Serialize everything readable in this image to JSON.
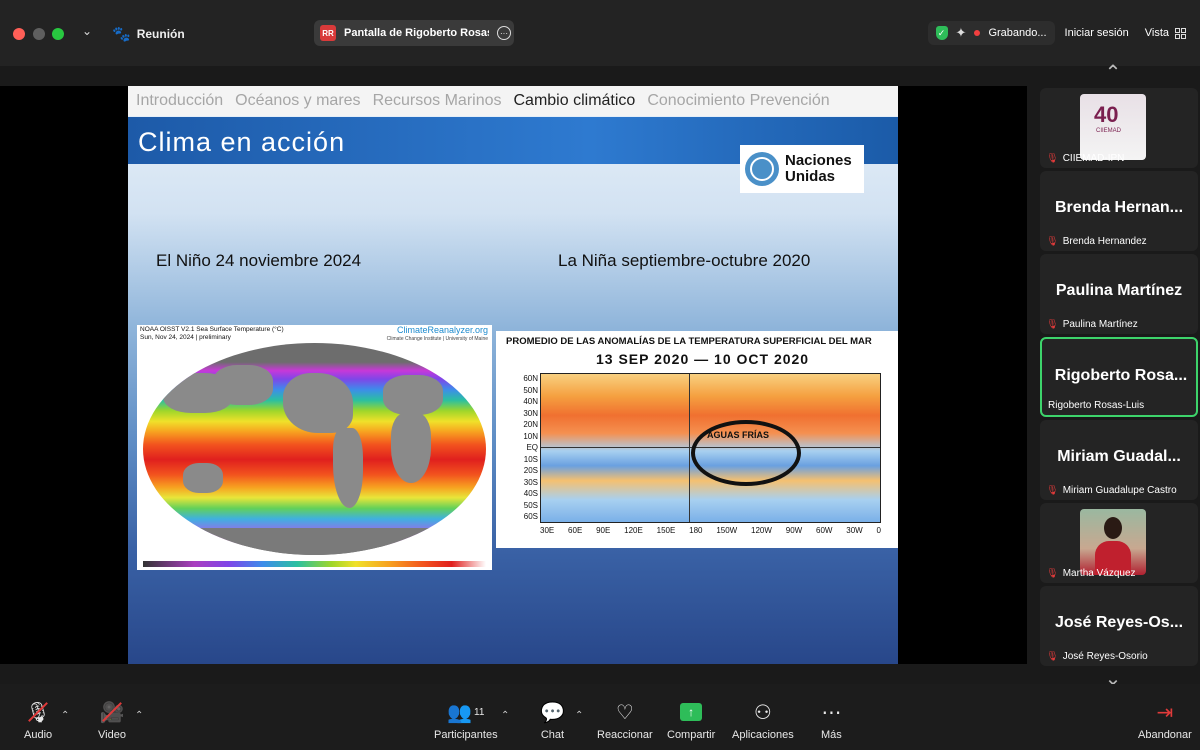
{
  "titlebar": {
    "app_title": "Reunión",
    "share_tab_badge": "RR",
    "share_tab_label": "Pantalla de Rigoberto Rosas-Luis",
    "recording_label": "Grabando...",
    "signin_label": "Iniciar sesión",
    "view_label": "Vista"
  },
  "slide": {
    "nav": [
      "Introducción",
      "Océanos y mares",
      "Recursos Marinos",
      "Cambio climático",
      "Conocimiento Prevención"
    ],
    "active_nav": 3,
    "title": "Clima en acción",
    "logo_text_1": "Naciones",
    "logo_text_2": "Unidas",
    "caption_left": "El Niño 24 noviembre 2024",
    "caption_right": "La Niña septiembre-octubre 2020",
    "map1": {
      "header_1": "NOAA OISST V2.1 Sea Surface Temperature (°C)",
      "header_2": "Sun, Nov 24, 2024 | preliminary",
      "brand": "ClimateReanalyzer.org",
      "brand_sub": "Climate Change Institute | University of Maine"
    },
    "map2": {
      "title_1": "PROMEDIO DE LAS ANOMALÍAS DE LA TEMPERATURA SUPERFICIAL DEL MAR",
      "title_2": "13 SEP 2020 — 10 OCT 2020",
      "annotation": "AGUAS FRÍAS",
      "y_ticks": [
        "60N",
        "50N",
        "40N",
        "30N",
        "20N",
        "10N",
        "EQ",
        "10S",
        "20S",
        "30S",
        "40S",
        "50S",
        "60S"
      ],
      "x_ticks": [
        "30E",
        "60E",
        "90E",
        "120E",
        "150E",
        "180",
        "150W",
        "120W",
        "90W",
        "60W",
        "30W",
        "0"
      ]
    }
  },
  "gallery": {
    "tiles": [
      {
        "name": "",
        "label": "CIIEMAD-IPN",
        "thumb": "ciiemad",
        "thumb_text": "40",
        "thumb_sub": "CIIEMAD"
      },
      {
        "name": "Brenda Hernan...",
        "label": "Brenda Hernandez"
      },
      {
        "name": "Paulina Martínez",
        "label": "Paulina Martínez"
      },
      {
        "name": "Rigoberto Rosa...",
        "label": "Rigoberto Rosas-Luis",
        "active": true
      },
      {
        "name": "Miriam Guadal...",
        "label": "Miriam Guadalupe Castro"
      },
      {
        "name": "",
        "label": "Martha Vázquez",
        "thumb": "martha"
      },
      {
        "name": "José Reyes-Os...",
        "label": "José Reyes-Osorio"
      }
    ]
  },
  "toolbar": {
    "audio": "Audio",
    "video": "Video",
    "participants": "Participantes",
    "participants_count": "11",
    "chat": "Chat",
    "react": "Reaccionar",
    "share": "Compartir",
    "apps": "Aplicaciones",
    "more": "Más",
    "leave": "Abandonar"
  },
  "colors": {
    "recording_dot": "#f23f3f",
    "active_speaker": "#3dd46b",
    "share_green": "#2ebd59",
    "mute_red": "#e03a3a"
  },
  "icons": [
    "paw-icon",
    "shield-icon",
    "sparkle-icon",
    "grid-view-icon",
    "microphone-muted-icon",
    "camera-muted-icon",
    "participants-icon",
    "chat-icon",
    "heart-icon",
    "share-screen-icon",
    "apps-icon",
    "more-icon",
    "leave-icon",
    "chevron-up-icon",
    "chevron-down-icon"
  ]
}
